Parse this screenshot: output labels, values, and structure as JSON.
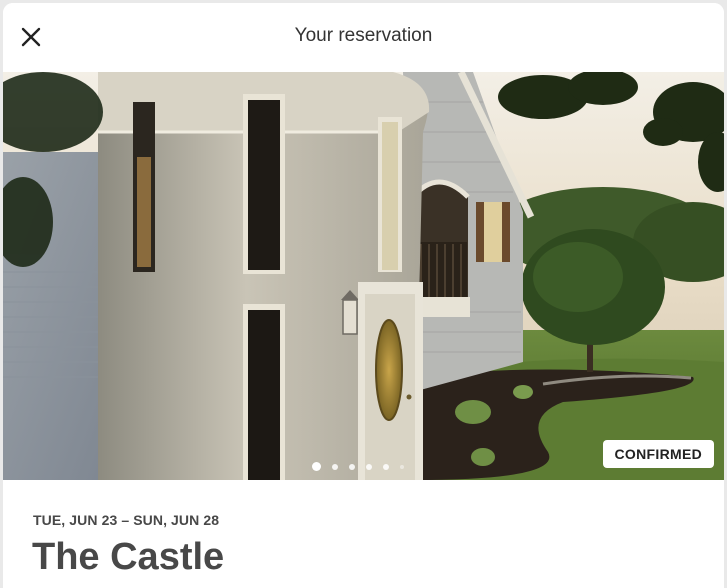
{
  "header": {
    "title": "Your reservation",
    "close_icon": "close-icon"
  },
  "hero": {
    "image_subject": "white house with round turret at sunset",
    "badge": "CONFIRMED",
    "carousel": {
      "active_index": 1,
      "total_dots": 6
    }
  },
  "reservation": {
    "dates": "TUE, JUN 23 – SUN, JUN 28",
    "listing_name": "The Castle"
  },
  "colors": {
    "text_dark": "#484848",
    "badge_bg": "#ffffff",
    "page_bg": "#ffffff"
  }
}
